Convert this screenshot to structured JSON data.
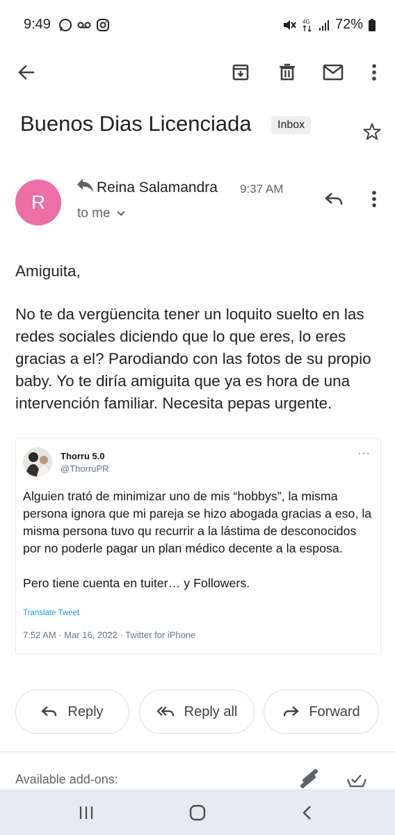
{
  "status_bar": {
    "time": "9:49",
    "battery": "72%"
  },
  "toolbar": {
    "icons": [
      "back-arrow-icon",
      "archive-icon",
      "trash-icon",
      "mail-icon",
      "more-vert-icon"
    ]
  },
  "email": {
    "subject": "Buenos Dias Licenciada",
    "label": "Inbox",
    "avatar_letter": "R",
    "avatar_color": "#ec6fa6",
    "sender": "Reina Salamandra",
    "time": "9:37 AM",
    "to": "to me",
    "greeting": "Amiguita,",
    "body": "No te da vergüencita tener un loquito suelto en las redes sociales diciendo que lo que eres, lo eres gracias a el? Parodiando con las fotos de su propio baby. Yo te diría amiguita que ya es hora de una intervención familiar. Necesita pepas urgente."
  },
  "tweet": {
    "name": "Thorru 5.0",
    "handle": "@ThorruPR",
    "more": "···",
    "text_1": "Alguien trató de minimizar uno de mis “hobbys”, la misma persona ignora que mi pareja se hizo abogada gracias a eso, la misma persona tuvo qu recurrir a la lástima de desconocidos por no poderle pagar un plan médico decente a la esposa.",
    "text_2": "Pero tiene cuenta en tuiter… y Followers.",
    "translate": "Translate Tweet",
    "meta": "7:52 AM · Mar 16, 2022 · Twitter for iPhone"
  },
  "actions": {
    "reply": "Reply",
    "reply_all": "Reply all",
    "forward": "Forward"
  },
  "addons": {
    "label": "Available add-ons:"
  },
  "colors": {
    "navbar": "#e7eaf3",
    "link": "#1b95e0"
  }
}
